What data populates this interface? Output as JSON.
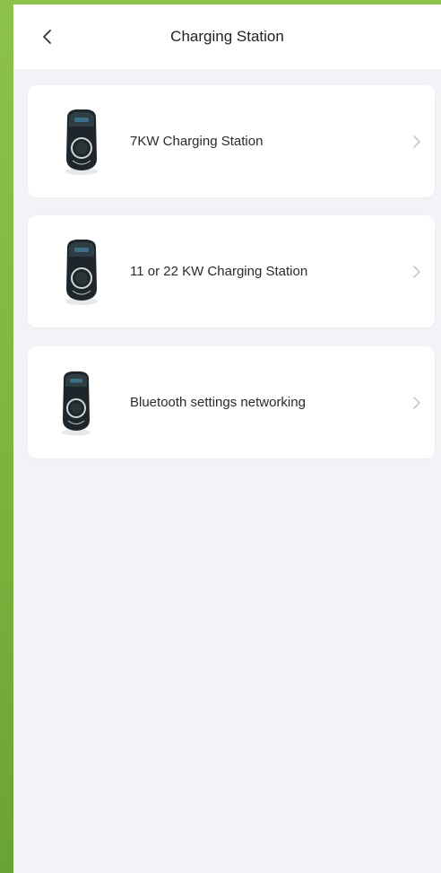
{
  "header": {
    "title": "Charging Station",
    "back_icon": "chevron-left-icon"
  },
  "items": [
    {
      "label": "7KW Charging Station",
      "icon": "charger-device-icon"
    },
    {
      "label": "11 or 22 KW Charging Station",
      "icon": "charger-device-icon"
    },
    {
      "label": "Bluetooth settings networking",
      "icon": "charger-device-icon"
    }
  ],
  "colors": {
    "background": "#f1f3f6",
    "card": "#ffffff",
    "outer_border": "#8cc24a",
    "text": "#2b2b2b",
    "chevron": "#c8c8c8"
  }
}
